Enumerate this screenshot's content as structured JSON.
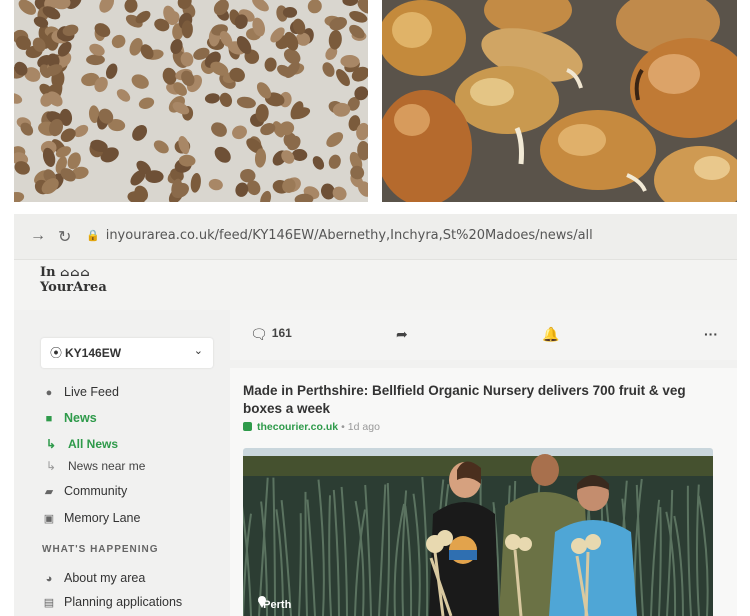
{
  "photos": {
    "top_left": {
      "subject": "dried-beans-on-cloth"
    },
    "top_right": {
      "subject": "sprouting-broad-beans"
    }
  },
  "browser": {
    "back_icon": "arrow-right-icon",
    "reload_icon": "reload-icon",
    "url": "inyourarea.co.uk/feed/KY146EW/Abernethy,Inchyra,St%20Madoes/news/all"
  },
  "site": {
    "logo_line1": "In",
    "logo_line2": "YourArea",
    "accent_color": "#2e9a4a"
  },
  "sidebar": {
    "location": "KY146EW",
    "items": [
      {
        "label": "Live Feed",
        "icon": "live-feed-icon"
      },
      {
        "label": "News",
        "icon": "news-icon"
      },
      {
        "label": "All News",
        "icon": "sub-arrow-icon"
      },
      {
        "label": "News near me",
        "icon": "sub-arrow-icon"
      },
      {
        "label": "Community",
        "icon": "chat-icon"
      },
      {
        "label": "Memory Lane",
        "icon": "camera-icon"
      }
    ],
    "section_title": "WHAT'S HAPPENING",
    "section_items": [
      {
        "label": "About my area",
        "icon": "pie-chart-icon"
      },
      {
        "label": "Planning applications",
        "icon": "planning-icon"
      }
    ]
  },
  "card": {
    "comment_count": "161",
    "headline": "Made in Perthshire: Bellfield Organic Nursery delivers 700 fruit & veg boxes a week",
    "source_name": "thecourier.co.uk",
    "separator": "•",
    "time_ago": "1d ago",
    "image_location": "Perth"
  }
}
